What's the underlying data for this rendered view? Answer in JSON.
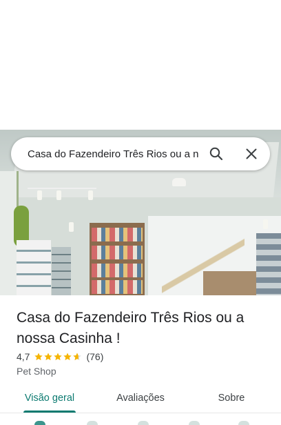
{
  "search": {
    "query": "Casa do Fazendeiro Três Rios ou a n"
  },
  "place": {
    "name": "Casa do Fazendeiro Três Rios ou a nossa Casinha !",
    "rating_value": "4,7",
    "rating_stars": 4.7,
    "review_count": "(76)",
    "category": "Pet Shop"
  },
  "tabs": [
    {
      "label": "Visão geral",
      "active": true
    },
    {
      "label": "Avaliações",
      "active": false
    },
    {
      "label": "Sobre",
      "active": false
    }
  ],
  "colors": {
    "accent": "#0b7a70",
    "star": "#f5b400",
    "text": "#202124"
  },
  "icons": {
    "search": "search-icon",
    "close": "close-icon",
    "star": "star-icon"
  }
}
